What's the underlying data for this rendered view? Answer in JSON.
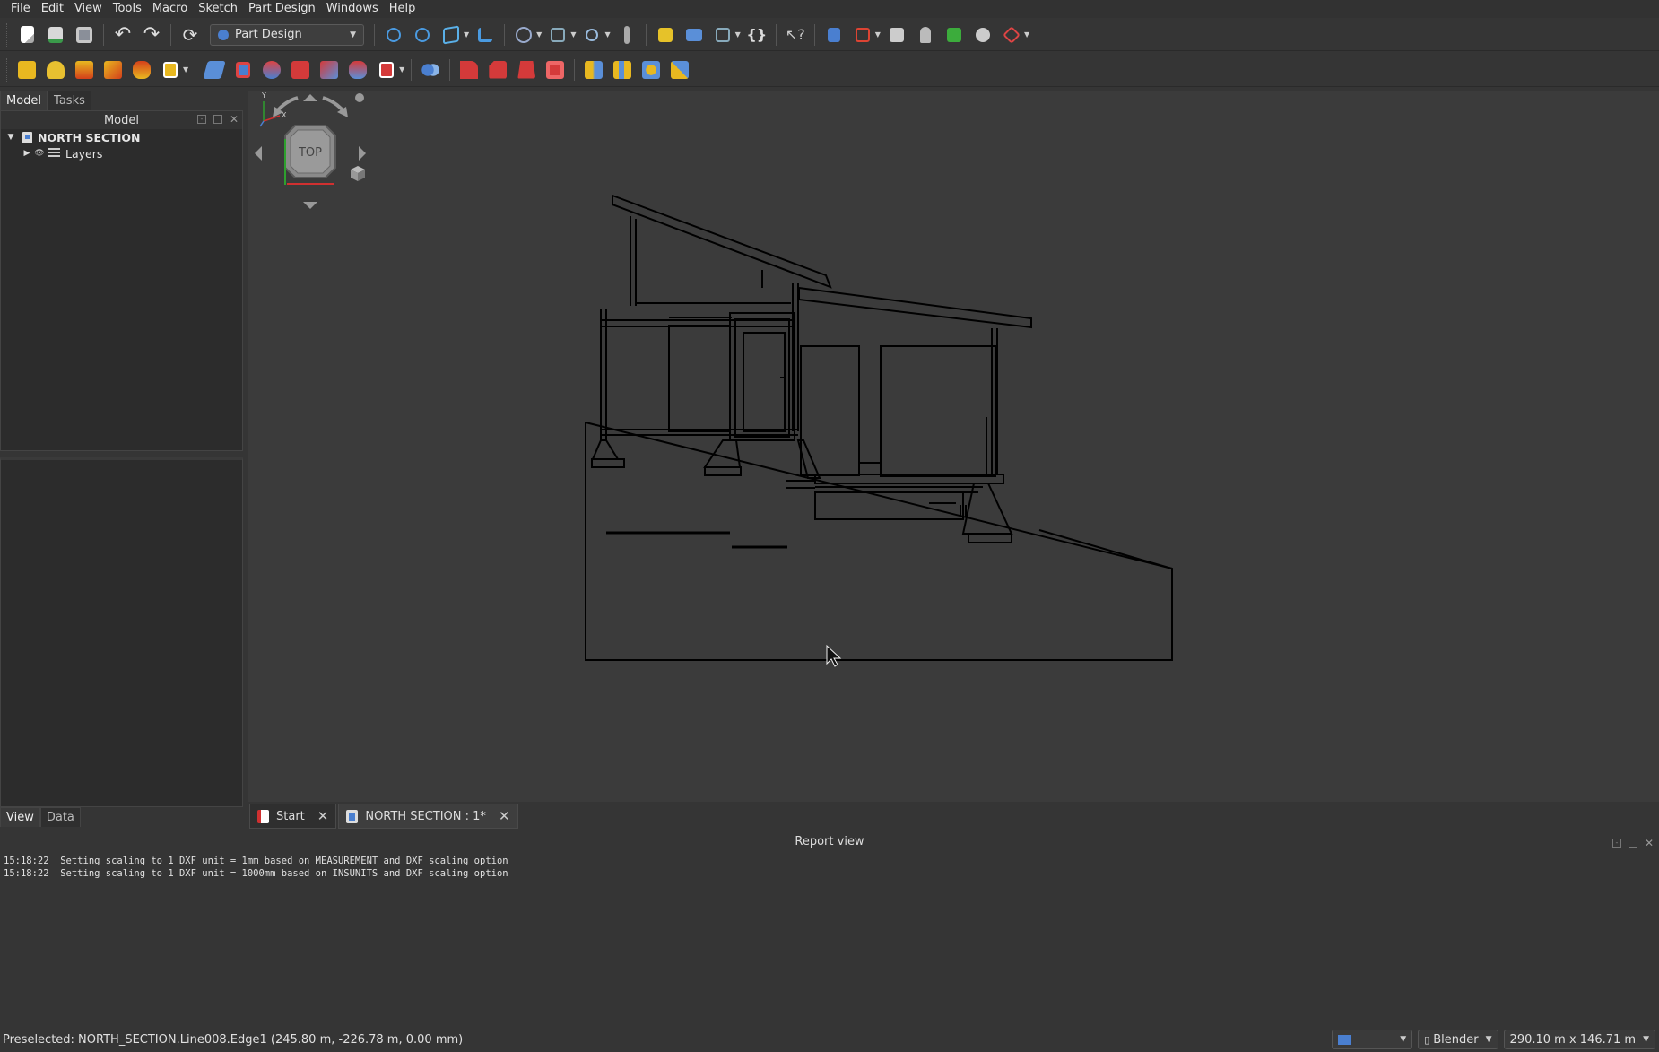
{
  "menu": [
    "File",
    "Edit",
    "View",
    "Tools",
    "Macro",
    "Sketch",
    "Part Design",
    "Windows",
    "Help"
  ],
  "toolbar": {
    "workbench": "Part Design",
    "icons_row1": [
      "new-file-icon",
      "open-file-icon",
      "save-icon",
      "undo-icon",
      "redo-icon",
      "refresh-icon",
      "fit-all-icon",
      "fit-selection-icon",
      "view-isometric-icon",
      "view-sync-icon",
      "draw-style-icon",
      "bounding-box-icon",
      "measure-icon",
      "measure-distance-icon",
      "part-icon",
      "group-icon",
      "link-icon",
      "macro-braces-icon",
      "whats-this-icon",
      "body-icon",
      "sketch-icon",
      "attach-icon",
      "shape-binder-icon",
      "sub-shape-binder-icon",
      "clone-icon",
      "datum-icon"
    ],
    "icons_row2": [
      "pad-icon",
      "revolution-icon",
      "additive-loft-icon",
      "additive-pipe-icon",
      "additive-helix-icon",
      "additive-primitive-icon",
      "pocket-icon",
      "hole-icon",
      "groove-icon",
      "subtractive-loft-icon",
      "subtractive-pipe-icon",
      "subtractive-helix-icon",
      "subtractive-primitive-icon",
      "boolean-icon",
      "fillet-icon",
      "chamfer-icon",
      "draft-icon",
      "thickness-icon",
      "mirrored-icon",
      "linear-pattern-icon",
      "polar-pattern-icon",
      "multitransform-icon"
    ]
  },
  "left_panel": {
    "tabs": [
      "Model",
      "Tasks"
    ],
    "active_tab": "Model",
    "header": "Model",
    "tree": {
      "document": "NORTH SECTION",
      "children": [
        "Layers"
      ]
    },
    "bottom_tabs": [
      "View",
      "Data"
    ]
  },
  "navcube": {
    "face": "TOP"
  },
  "doc_tabs": [
    {
      "label": "Start"
    },
    {
      "label": "NORTH SECTION : 1*"
    }
  ],
  "report": {
    "title": "Report view",
    "lines": [
      "15:18:22  Setting scaling to 1 DXF unit = 1mm based on MEASUREMENT and DXF scaling option",
      "15:18:22  Setting scaling to 1 DXF unit = 1000mm based on INSUNITS and DXF scaling option"
    ]
  },
  "status": {
    "message": "Preselected: NORTH_SECTION.Line008.Edge1 (245.80 m, -226.78 m, 0.00 mm)",
    "nav_style": "Blender",
    "dimensions": "290.10 m x 146.71 m"
  },
  "colors": {
    "background": "#3b3b3b",
    "panel": "#2c2c2c",
    "accent_blue": "#4a7fd0",
    "line": "#000000"
  }
}
